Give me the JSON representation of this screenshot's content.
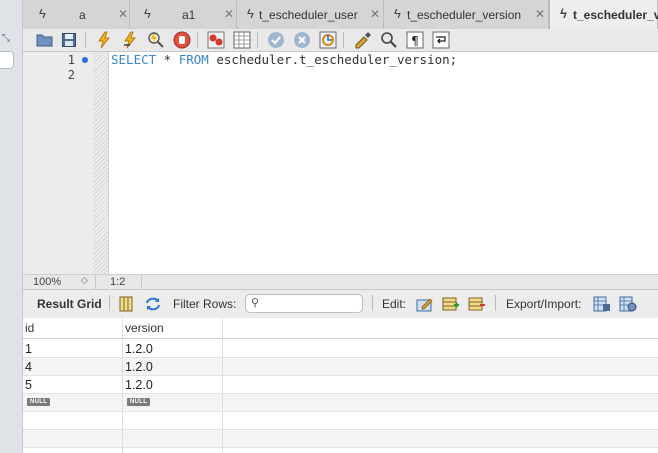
{
  "tabs": [
    {
      "label": "a",
      "closable": true
    },
    {
      "label": "a1",
      "closable": true
    },
    {
      "label": "t_escheduler_user",
      "closable": true
    },
    {
      "label": "t_escheduler_version",
      "closable": true
    },
    {
      "label": "t_escheduler_ve",
      "active": true
    }
  ],
  "toolbar_icons": [
    "open-folder-icon",
    "save-icon",
    "execute-icon",
    "execute-current-icon",
    "explain-icon",
    "stop-icon",
    "toggle-error-icon",
    "toggle-output-icon",
    "commit-icon",
    "rollback-icon",
    "autocommit-icon",
    "beautify-icon",
    "find-icon",
    "invisible-chars-icon",
    "wrap-icon"
  ],
  "editor": {
    "line_numbers": [
      "1",
      "2"
    ],
    "query": {
      "kw1": "SELECT",
      "star": " * ",
      "kw2": "FROM",
      "rest": " escheduler.t_escheduler_version;"
    }
  },
  "status": {
    "zoom": "100%",
    "position": "1:2"
  },
  "result_toolbar": {
    "result_grid_label": "Result Grid",
    "filter_label": "Filter Rows:",
    "filter_placeholder": "",
    "edit_label": "Edit:",
    "export_label": "Export/Import:"
  },
  "grid": {
    "columns": [
      "id",
      "version"
    ],
    "rows": [
      [
        "1",
        "1.2.0"
      ],
      [
        "4",
        "1.2.0"
      ],
      [
        "5",
        "1.2.0"
      ]
    ],
    "null_label": "NULL"
  },
  "colors": {
    "keyword": "#3a86c8",
    "accent_blue": "#2b6fd8"
  }
}
